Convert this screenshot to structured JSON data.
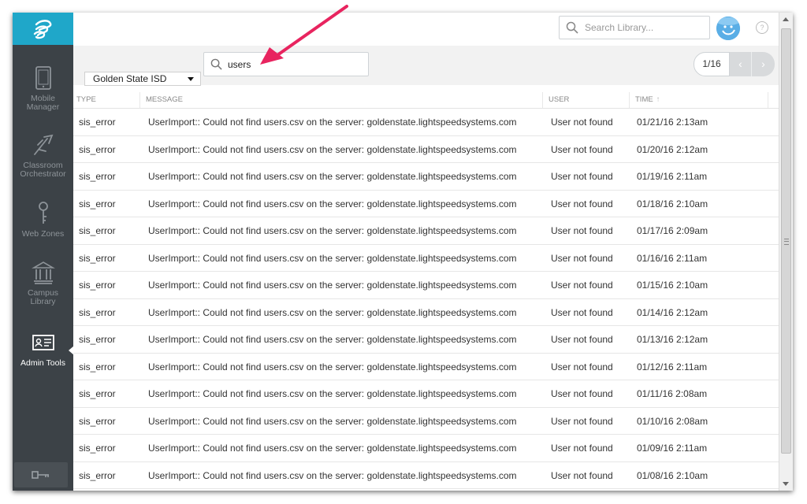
{
  "header": {
    "search_placeholder": "Search Library...",
    "help": "?"
  },
  "sidebar": {
    "items": [
      {
        "label": "Mobile Manager"
      },
      {
        "label": "Classroom Orchestrator"
      },
      {
        "label": "Web Zones"
      },
      {
        "label": "Campus Library"
      },
      {
        "label": "Admin Tools",
        "active": true
      }
    ]
  },
  "toolbar": {
    "district": "Golden State ISD",
    "filter_value": "users",
    "pager": {
      "count": "1/16",
      "prev": "‹",
      "next": "›"
    }
  },
  "table": {
    "columns": {
      "type": "TYPE",
      "message": "MESSAGE",
      "user": "USER",
      "time": "TIME"
    },
    "sort_arrow": "↑",
    "rows": [
      {
        "type": "sis_error",
        "message": "UserImport:: Could not find users.csv on the server: goldenstate.lightspeedsystems.com",
        "user": "User not found",
        "time": "01/21/16 2:13am"
      },
      {
        "type": "sis_error",
        "message": "UserImport:: Could not find users.csv on the server: goldenstate.lightspeedsystems.com",
        "user": "User not found",
        "time": "01/20/16 2:12am"
      },
      {
        "type": "sis_error",
        "message": "UserImport:: Could not find users.csv on the server: goldenstate.lightspeedsystems.com",
        "user": "User not found",
        "time": "01/19/16 2:11am"
      },
      {
        "type": "sis_error",
        "message": "UserImport:: Could not find users.csv on the server: goldenstate.lightspeedsystems.com",
        "user": "User not found",
        "time": "01/18/16 2:10am"
      },
      {
        "type": "sis_error",
        "message": "UserImport:: Could not find users.csv on the server: goldenstate.lightspeedsystems.com",
        "user": "User not found",
        "time": "01/17/16 2:09am"
      },
      {
        "type": "sis_error",
        "message": "UserImport:: Could not find users.csv on the server: goldenstate.lightspeedsystems.com",
        "user": "User not found",
        "time": "01/16/16 2:11am"
      },
      {
        "type": "sis_error",
        "message": "UserImport:: Could not find users.csv on the server: goldenstate.lightspeedsystems.com",
        "user": "User not found",
        "time": "01/15/16 2:10am"
      },
      {
        "type": "sis_error",
        "message": "UserImport:: Could not find users.csv on the server: goldenstate.lightspeedsystems.com",
        "user": "User not found",
        "time": "01/14/16 2:12am"
      },
      {
        "type": "sis_error",
        "message": "UserImport:: Could not find users.csv on the server: goldenstate.lightspeedsystems.com",
        "user": "User not found",
        "time": "01/13/16 2:12am"
      },
      {
        "type": "sis_error",
        "message": "UserImport:: Could not find users.csv on the server: goldenstate.lightspeedsystems.com",
        "user": "User not found",
        "time": "01/12/16 2:11am"
      },
      {
        "type": "sis_error",
        "message": "UserImport:: Could not find users.csv on the server: goldenstate.lightspeedsystems.com",
        "user": "User not found",
        "time": "01/11/16 2:08am"
      },
      {
        "type": "sis_error",
        "message": "UserImport:: Could not find users.csv on the server: goldenstate.lightspeedsystems.com",
        "user": "User not found",
        "time": "01/10/16 2:08am"
      },
      {
        "type": "sis_error",
        "message": "UserImport:: Could not find users.csv on the server: goldenstate.lightspeedsystems.com",
        "user": "User not found",
        "time": "01/09/16 2:11am"
      },
      {
        "type": "sis_error",
        "message": "UserImport:: Could not find users.csv on the server: goldenstate.lightspeedsystems.com",
        "user": "User not found",
        "time": "01/08/16 2:10am"
      }
    ]
  },
  "colors": {
    "brand": "#1fa7c9",
    "sidebar": "#3c4247",
    "annotation_arrow": "#e8245f"
  }
}
